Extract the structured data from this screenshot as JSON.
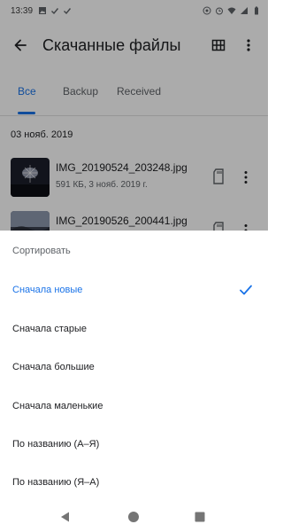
{
  "status_bar": {
    "time": "13:39",
    "left_icons": [
      "image-icon",
      "check-icon",
      "check-icon"
    ],
    "right_icons": [
      "hotspot-icon",
      "alarm-icon",
      "wifi-icon",
      "signal-icon",
      "battery-icon"
    ]
  },
  "app_bar": {
    "title": "Скачанные файлы",
    "actions": [
      "grid-view-icon",
      "more-vert-icon"
    ]
  },
  "tabs": [
    {
      "label": "Все",
      "active": true
    },
    {
      "label": "Backup",
      "active": false
    },
    {
      "label": "Received",
      "active": false
    }
  ],
  "list": {
    "section_header": "03 нояб. 2019",
    "files": [
      {
        "name": "IMG_20190524_203248.jpg",
        "meta": "591 КБ, 3 нояб. 2019 г."
      },
      {
        "name": "IMG_20190526_200441.jpg",
        "meta": ""
      }
    ]
  },
  "sort_sheet": {
    "title": "Сортировать",
    "options": [
      {
        "label": "Сначала новые",
        "selected": true
      },
      {
        "label": "Сначала старые",
        "selected": false
      },
      {
        "label": "Сначала большие",
        "selected": false
      },
      {
        "label": "Сначала маленькие",
        "selected": false
      },
      {
        "label": "По названию (А–Я)",
        "selected": false
      },
      {
        "label": "По названию (Я–А)",
        "selected": false
      }
    ]
  },
  "colors": {
    "accent": "#1a73e8",
    "text_primary": "#202124",
    "text_secondary": "#5f6368",
    "scrim": "rgba(0,0,0,0.33)"
  }
}
